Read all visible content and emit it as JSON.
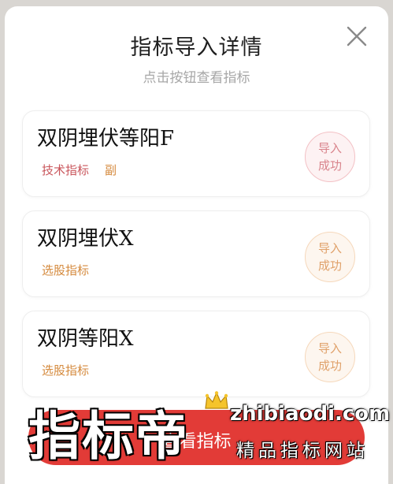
{
  "dialog": {
    "title": "指标导入详情",
    "subtitle": "点击按钮查看指标"
  },
  "close_icon": "close-icon",
  "items": [
    {
      "name": "双阴埋伏等阳F",
      "tags": [
        "技术指标",
        "副"
      ],
      "status_line1": "导入",
      "status_line2": "成功",
      "status_color": "#d9848c"
    },
    {
      "name": "双阴埋伏X",
      "tags": [
        "选股指标"
      ],
      "status_line1": "导入",
      "status_line2": "成功",
      "status_color": "#e0a16a"
    },
    {
      "name": "双阴等阳X",
      "tags": [
        "选股指标"
      ],
      "status_line1": "导入",
      "status_line2": "成功",
      "status_color": "#e0a16a"
    }
  ],
  "bottom_button": {
    "label": "查看指标"
  },
  "watermark": {
    "brand": "指标帝",
    "domain": "zhibiaodi.com",
    "slogan": "精品指标网站"
  },
  "colors": {
    "accent_red": "#e23b37",
    "tag_red": "#c9555b",
    "tag_orange": "#d58a3d"
  }
}
